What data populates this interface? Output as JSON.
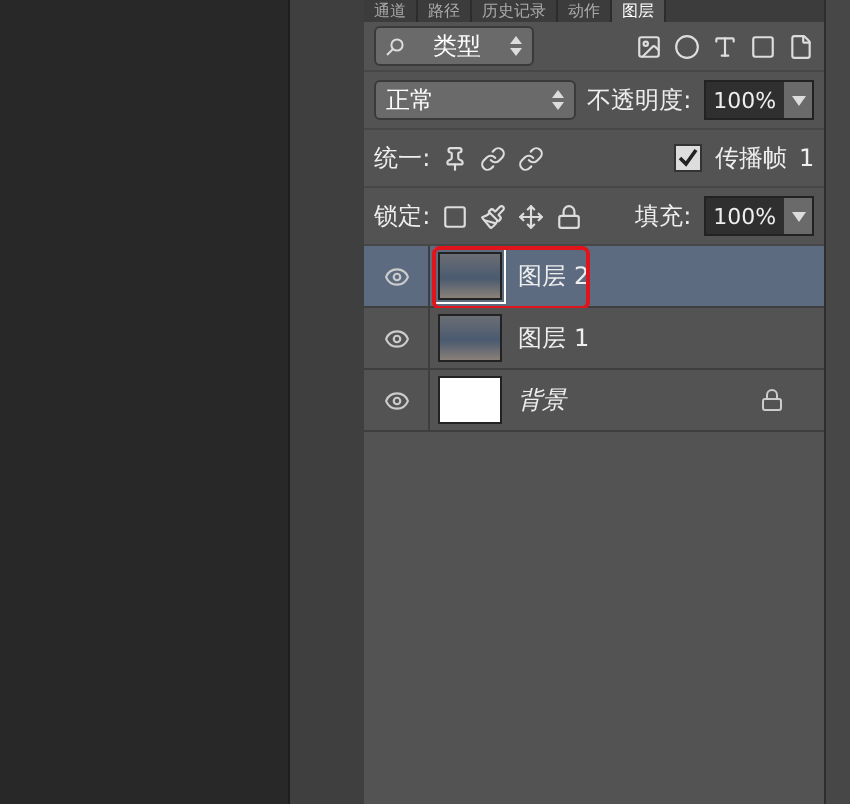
{
  "tabs": [
    {
      "label": "通道",
      "selected": false
    },
    {
      "label": "路径",
      "selected": false
    },
    {
      "label": "历史记录",
      "selected": false
    },
    {
      "label": "动作",
      "selected": false
    },
    {
      "label": "图层",
      "selected": true
    }
  ],
  "filter": {
    "value": "类型"
  },
  "blend": {
    "mode": "正常",
    "opacity_label": "不透明度:",
    "opacity": "100%"
  },
  "unify": {
    "label": "统一:",
    "propagate_label": "传播帧",
    "propagate_checked": true,
    "frame": "1"
  },
  "lock": {
    "label": "锁定:",
    "fill_label": "填充:",
    "fill": "100%"
  },
  "layers": [
    {
      "name": "图层 2",
      "kind": "photo",
      "selected": true,
      "highlighted": true,
      "locked": false,
      "italic": false
    },
    {
      "name": "图层 1",
      "kind": "photo",
      "selected": false,
      "highlighted": false,
      "locked": false,
      "italic": false
    },
    {
      "name": "背景",
      "kind": "blank",
      "selected": false,
      "highlighted": false,
      "locked": true,
      "italic": true
    }
  ]
}
